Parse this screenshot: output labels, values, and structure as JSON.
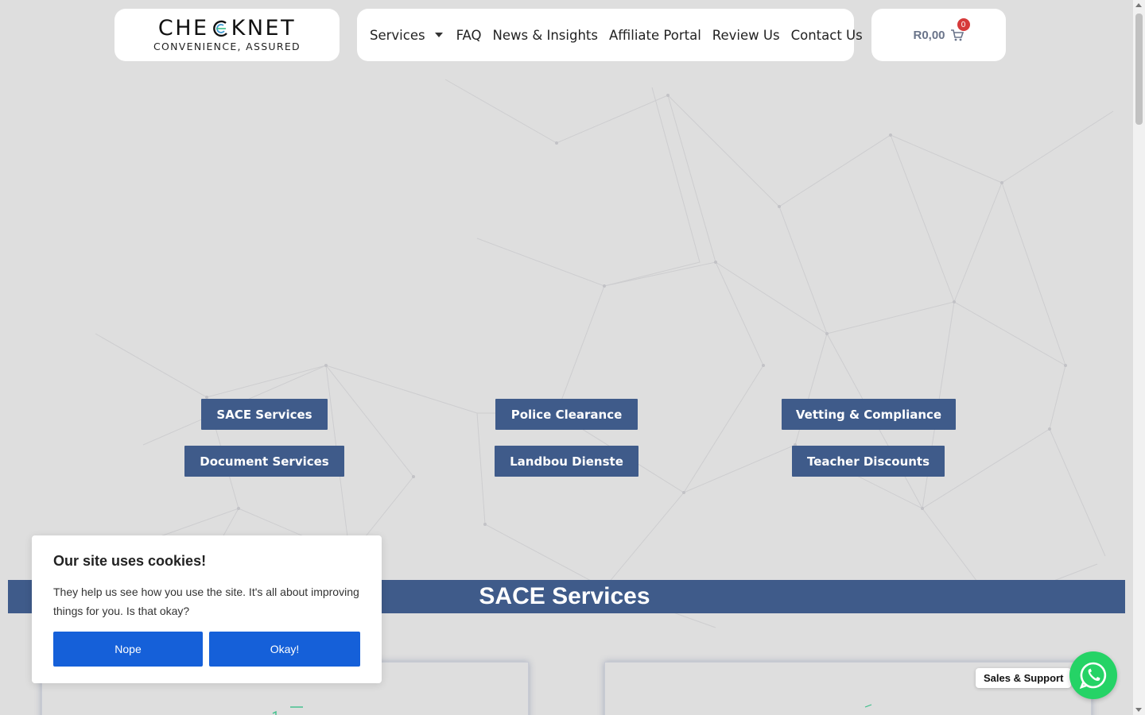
{
  "header": {
    "logo": {
      "name": "CHECKNET",
      "tagline": "CONVENIENCE, ASSURED"
    },
    "nav": [
      {
        "label": "Services",
        "has_dropdown": true
      },
      {
        "label": "FAQ"
      },
      {
        "label": "News & Insights"
      },
      {
        "label": "Affiliate Portal"
      },
      {
        "label": "Review Us"
      },
      {
        "label": "Contact Us"
      }
    ],
    "cart": {
      "total": "R0,00",
      "count": "0",
      "icon": "cart-icon"
    }
  },
  "service_buttons": [
    "SACE Services",
    "Police Clearance",
    "Vetting & Compliance",
    "Document Services",
    "Landbou Dienste",
    "Teacher Discounts"
  ],
  "section": {
    "title": "SACE Services"
  },
  "cookie": {
    "title": "Our site uses cookies!",
    "text": "They help us see how you use the site. It's all about improving things for you. Is that okay?",
    "decline": "Nope",
    "accept": "Okay!"
  },
  "whatsapp": {
    "label": "Sales & Support",
    "icon": "whatsapp-icon"
  },
  "colors": {
    "background": "#dedede",
    "button": "#3f5b8a",
    "cookie_button": "#1560d9",
    "whatsapp": "#25d366",
    "badge": "#d63a3a"
  }
}
